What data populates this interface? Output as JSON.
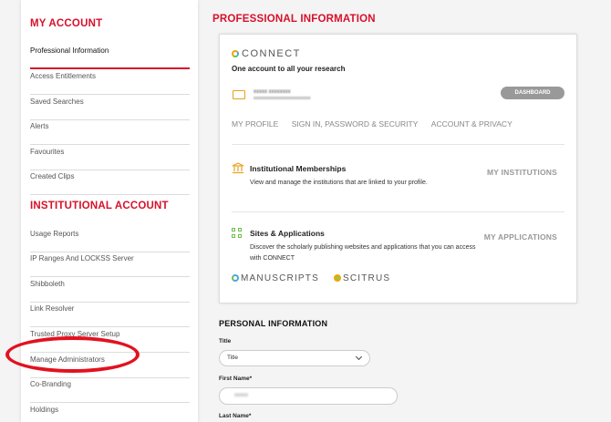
{
  "sidebar": {
    "my_account_heading": "MY ACCOUNT",
    "my_account_items": [
      {
        "label": "Professional Information"
      },
      {
        "label": "Access Entitlements"
      },
      {
        "label": "Saved Searches"
      },
      {
        "label": "Alerts"
      },
      {
        "label": "Favourites"
      },
      {
        "label": "Created Clips"
      }
    ],
    "institutional_heading": "INSTITUTIONAL ACCOUNT",
    "institutional_items": [
      {
        "label": "Usage Reports"
      },
      {
        "label": "IP Ranges And LOCKSS Server"
      },
      {
        "label": "Shibboleth"
      },
      {
        "label": "Link Resolver"
      },
      {
        "label": "Trusted Proxy Server Setup"
      },
      {
        "label": "Manage Administrators"
      },
      {
        "label": "Co-Branding"
      },
      {
        "label": "Holdings"
      }
    ]
  },
  "main": {
    "heading": "PROFESSIONAL INFORMATION",
    "connect": {
      "logo_text": "CONNECT",
      "tagline": "One account to all your research",
      "dashboard_label": "DASHBOARD",
      "tabs": [
        {
          "label": "MY PROFILE"
        },
        {
          "label": "SIGN IN, PASSWORD & SECURITY"
        },
        {
          "label": "ACCOUNT & PRIVACY"
        }
      ],
      "memberships": {
        "title": "Institutional Memberships",
        "desc": "View and manage the institutions that are linked to your profile.",
        "link": "MY INSTITUTIONS"
      },
      "sites": {
        "title": "Sites & Applications",
        "desc": "Discover the scholarly publishing websites and applications that you can access with CONNECT",
        "link": "MY APPLICATIONS"
      },
      "apps": [
        {
          "label": "MANUSCRIPTS"
        },
        {
          "label": "SCITRUS"
        }
      ]
    },
    "personal": {
      "heading": "PERSONAL INFORMATION",
      "title_label": "Title",
      "title_value": "Title",
      "first_name_label": "First Name*",
      "last_name_label": "Last Name*"
    }
  },
  "colors": {
    "accent_red": "#d8102b",
    "annotation_red": "#e3111f"
  }
}
